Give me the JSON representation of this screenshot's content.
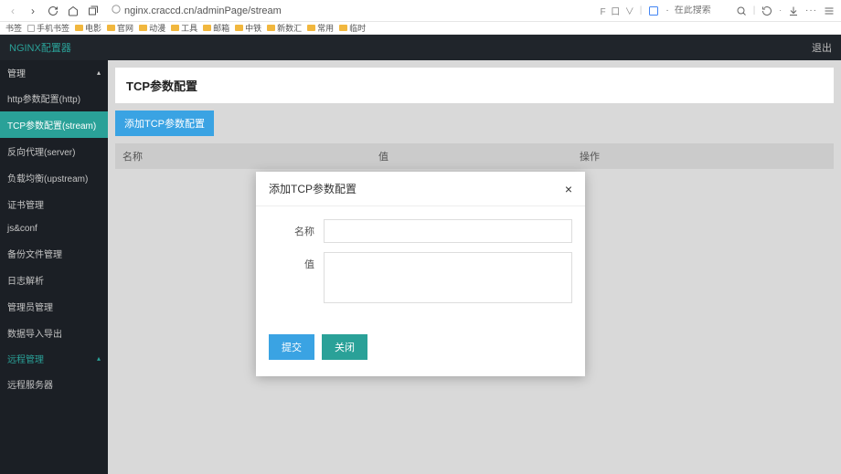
{
  "browser": {
    "url": "nginx.craccd.cn/adminPage/stream",
    "rightLabel": "在此搜索",
    "bookmarks_label": "书签",
    "bookmarks": [
      {
        "label": "手机书签",
        "type": "page"
      },
      {
        "label": "电影",
        "type": "folder"
      },
      {
        "label": "官网",
        "type": "folder"
      },
      {
        "label": "动漫",
        "type": "folder"
      },
      {
        "label": "工具",
        "type": "folder"
      },
      {
        "label": "邮箱",
        "type": "folder"
      },
      {
        "label": "中铁",
        "type": "folder"
      },
      {
        "label": "新数汇",
        "type": "folder"
      },
      {
        "label": "常用",
        "type": "folder"
      },
      {
        "label": "临时",
        "type": "folder"
      }
    ]
  },
  "app": {
    "brand": "NGINX配置器",
    "logout": "退出"
  },
  "sidebar": {
    "groups": [
      {
        "label": "管理",
        "expanded": true
      },
      {
        "label": "远程管理",
        "expanded": true
      }
    ],
    "items": [
      {
        "label": "http参数配置(http)"
      },
      {
        "label": "TCP参数配置(stream)",
        "active": true
      },
      {
        "label": "反向代理(server)"
      },
      {
        "label": "负载均衡(upstream)"
      },
      {
        "label": "证书管理"
      },
      {
        "label": "js&conf"
      },
      {
        "label": "备份文件管理"
      },
      {
        "label": "日志解析"
      },
      {
        "label": "管理员管理"
      },
      {
        "label": "数据导入导出"
      }
    ],
    "remote_items": [
      {
        "label": "远程服务器"
      }
    ]
  },
  "page": {
    "title": "TCP参数配置",
    "addBtn": "添加TCP参数配置",
    "cols": {
      "name": "名称",
      "value": "值",
      "op": "操作"
    }
  },
  "modal": {
    "title": "添加TCP参数配置",
    "nameLabel": "名称",
    "valueLabel": "值",
    "submit": "提交",
    "close": "关闭"
  }
}
